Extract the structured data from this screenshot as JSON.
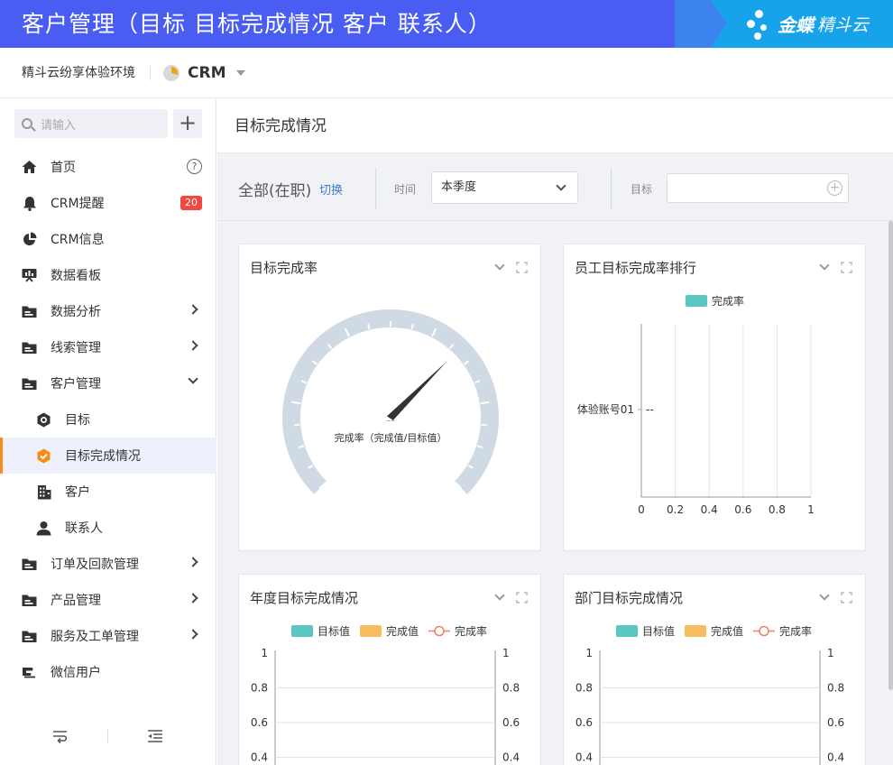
{
  "banner": {
    "title": "客户管理（目标 目标完成情况 客户 联系人）",
    "brand_name": "金蝶",
    "brand_product": "精斗云"
  },
  "topbar": {
    "env_name": "精斗云纷享体验环境",
    "app_name": "CRM"
  },
  "sidebar": {
    "search_placeholder": "请输入",
    "add_label": "+",
    "items": [
      {
        "label": "首页",
        "icon": "home-icon"
      },
      {
        "label": "CRM提醒",
        "icon": "bell-icon",
        "badge": "20"
      },
      {
        "label": "CRM信息",
        "icon": "pie-icon"
      },
      {
        "label": "数据看板",
        "icon": "dashboard-icon"
      },
      {
        "label": "数据分析",
        "icon": "folder-icon"
      },
      {
        "label": "线索管理",
        "icon": "folder-icon"
      },
      {
        "label": "客户管理",
        "icon": "folder-icon"
      },
      {
        "label": "目标",
        "icon": "target-icon"
      },
      {
        "label": "目标完成情况",
        "icon": "shield-check-icon"
      },
      {
        "label": "客户",
        "icon": "building-icon"
      },
      {
        "label": "联系人",
        "icon": "person-icon"
      },
      {
        "label": "订单及回款管理",
        "icon": "folder-icon"
      },
      {
        "label": "产品管理",
        "icon": "folder-icon"
      },
      {
        "label": "服务及工单管理",
        "icon": "folder-icon"
      },
      {
        "label": "微信用户",
        "icon": "wechat-user-icon"
      }
    ],
    "help_label": "?"
  },
  "main": {
    "page_title": "目标完成情况",
    "filter": {
      "scope": "全部(在职)",
      "switch_label": "切换",
      "time_label": "时间",
      "time_value": "本季度",
      "target_label": "目标"
    },
    "cards": {
      "gauge": {
        "title": "目标完成率",
        "value_text": "--",
        "caption": "完成率（完成值/目标值）"
      },
      "ranking": {
        "title": "员工目标完成率排行"
      },
      "annual": {
        "title": "年度目标完成情况"
      },
      "department": {
        "title": "部门目标完成情况"
      }
    }
  },
  "chart_data": [
    {
      "type": "gauge",
      "title": "目标完成率",
      "value": null,
      "display_value": "--",
      "label": "完成率（完成值/目标值）"
    },
    {
      "type": "bar",
      "orientation": "horizontal",
      "title": "员工目标完成率排行",
      "categories": [
        "体验账号01"
      ],
      "series": [
        {
          "name": "完成率",
          "values": [
            null
          ],
          "labels": [
            "--"
          ]
        }
      ],
      "xticks": [
        "0",
        "0.2",
        "0.4",
        "0.6",
        "0.8",
        "1"
      ],
      "xlim": [
        0,
        1
      ],
      "legend": "top",
      "colors": {
        "完成率": "#5ac8c0"
      }
    },
    {
      "type": "bar",
      "title": "年度目标完成情况",
      "series": [
        {
          "name": "目标值",
          "values": []
        },
        {
          "name": "完成值",
          "values": []
        },
        {
          "name": "完成率",
          "values": []
        }
      ],
      "yticks_left": [
        "1",
        "0.8",
        "0.6",
        "0.4"
      ],
      "yticks_right": [
        "1",
        "0.8",
        "0.6",
        "0.4"
      ],
      "legend": "top",
      "colors": {
        "目标值": "#5ac8c0",
        "完成值": "#f8bd5f",
        "完成率": "#ef7e63"
      }
    },
    {
      "type": "bar",
      "title": "部门目标完成情况",
      "series": [
        {
          "name": "目标值",
          "values": []
        },
        {
          "name": "完成值",
          "values": []
        },
        {
          "name": "完成率",
          "values": []
        }
      ],
      "yticks_left": [
        "1",
        "0.8",
        "0.6",
        "0.4"
      ],
      "yticks_right": [
        "1",
        "0.8",
        "0.6",
        "0.4"
      ],
      "legend": "top",
      "colors": {
        "目标值": "#5ac8c0",
        "完成值": "#f8bd5f",
        "完成率": "#ef7e63"
      }
    }
  ]
}
